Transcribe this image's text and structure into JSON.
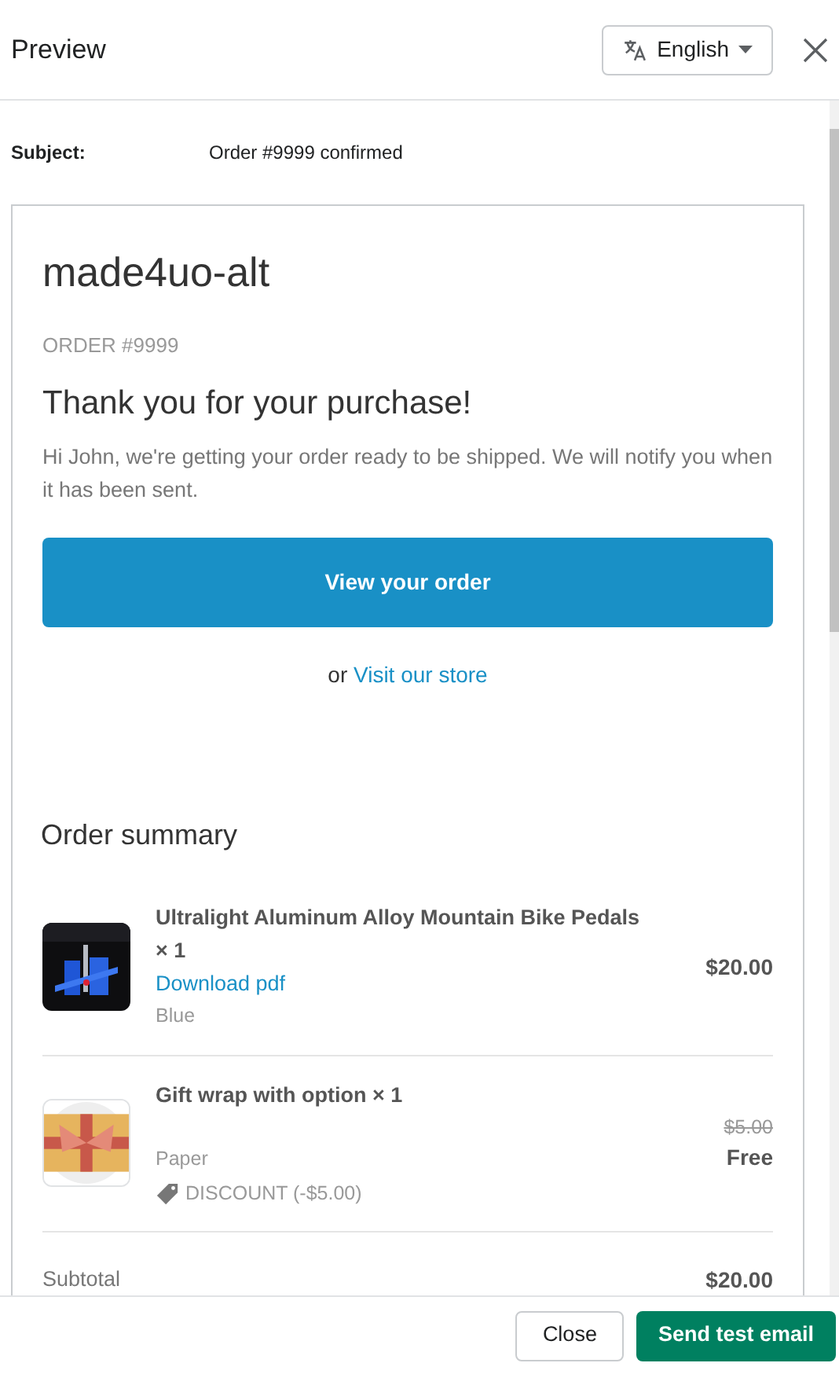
{
  "header": {
    "title": "Preview",
    "language": "English"
  },
  "subject": {
    "label": "Subject:",
    "value": "Order #9999 confirmed"
  },
  "email": {
    "shop_name": "made4uo-alt",
    "order_number": "ORDER #9999",
    "heading": "Thank you for your purchase!",
    "message": "Hi John, we're getting your order ready to be shipped. We will notify you when it has been sent.",
    "button": "View your order",
    "store_prefix": "or",
    "store_link": "Visit our store",
    "summary_title": "Order summary",
    "items": [
      {
        "kind": "picture",
        "title": "Ultralight Aluminum Alloy Mountain Bike Pedals × 1",
        "link": "Download pdf",
        "variant": "Blue",
        "price": "$20.00"
      },
      {
        "kind": "picture",
        "title": "Gift wrap with option × 1",
        "variant": "Paper",
        "discount": "DISCOUNT (-$5.00)",
        "original_price": "$5.00",
        "price": "Free"
      }
    ],
    "subtotal": {
      "label": "Subtotal",
      "value": "$20.00"
    }
  },
  "footer": {
    "buttons": [
      {
        "label": "Close",
        "kind": "secondary"
      },
      {
        "label": "Send test email",
        "kind": "primary"
      }
    ]
  }
}
